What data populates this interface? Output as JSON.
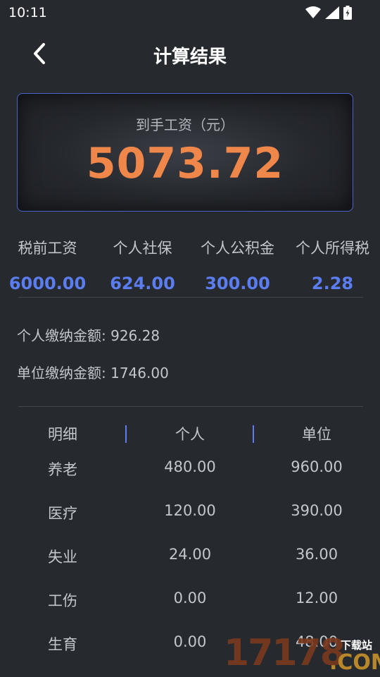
{
  "status_bar": {
    "time": "10:11"
  },
  "header": {
    "title": "计算结果"
  },
  "net_salary": {
    "label": "到手工资（元）",
    "value": "5073.72"
  },
  "summary": {
    "columns": [
      {
        "label": "税前工资",
        "value": "6000.00"
      },
      {
        "label": "个人社保",
        "value": "624.00"
      },
      {
        "label": "个人公积金",
        "value": "300.00"
      },
      {
        "label": "个人所得税",
        "value": "2.28"
      }
    ]
  },
  "totals": {
    "personal": "个人缴纳金额: 926.28",
    "employer": "单位缴纳金额: 1746.00"
  },
  "detail_table": {
    "headers": [
      "明细",
      "个人",
      "单位"
    ],
    "rows": [
      {
        "item": "养老",
        "personal": "480.00",
        "employer": "960.00"
      },
      {
        "item": "医疗",
        "personal": "120.00",
        "employer": "390.00"
      },
      {
        "item": "失业",
        "personal": "24.00",
        "employer": "36.00"
      },
      {
        "item": "工伤",
        "personal": "0.00",
        "employer": "12.00"
      },
      {
        "item": "生育",
        "personal": "0.00",
        "employer": "48.00"
      }
    ]
  },
  "watermark": {
    "digits": "17178",
    "domain": ".COM",
    "tag": "下载站"
  },
  "colors": {
    "background": "#262a2f",
    "accent_blue": "#5b7df0",
    "net_orange": "#f0874a",
    "card_border": "#4a64c9"
  },
  "icons": [
    "wifi-icon",
    "signal-icon",
    "battery-icon",
    "back-arrow-icon"
  ]
}
